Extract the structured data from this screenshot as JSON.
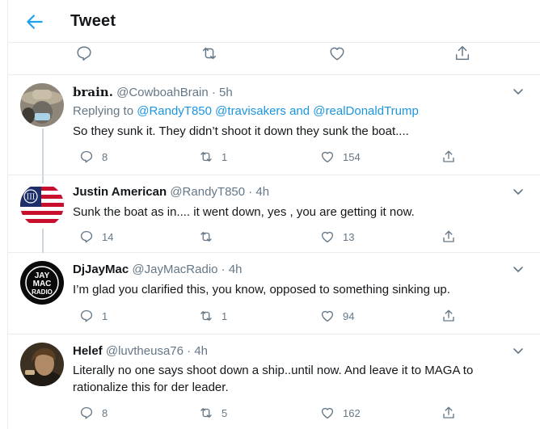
{
  "header": {
    "title": "Tweet"
  },
  "tweets": [
    {
      "name": "𝐛𝐫𝐚𝐢𝐧.",
      "handle": "@CowboahBrain · 5h",
      "replying_prefix": "Replying to",
      "replying_to_1": "@RandyT850",
      "replying_to_2": "@travisakers",
      "replying_and": "and",
      "replying_to_3": "@realDonaldTrump",
      "text": "So they sunk it. They didn’t shoot it down they sunk the boat....",
      "replies": "8",
      "retweets": "1",
      "likes": "154"
    },
    {
      "name": "Justin American",
      "handle": "@RandyT850 · 4h",
      "text": "Sunk the boat  as in.... it went down, yes , you are getting it now.",
      "replies": "14",
      "retweets": "",
      "likes": "13"
    },
    {
      "name": "DjJayMac",
      "handle": "@JayMacRadio · 4h",
      "text": "I’m glad you clarified this, you know, opposed to something sinking up.",
      "replies": "1",
      "retweets": "1",
      "likes": "94",
      "avatar_text": "JAY MAC RADIO"
    },
    {
      "name": "Helef",
      "handle": "@luvtheusa76 · 4h",
      "text": "Literally no one says shoot down a ship..until now. And leave it to MAGA to rationalize this for der leader.",
      "replies": "8",
      "retweets": "5",
      "likes": "162"
    }
  ],
  "colors": {
    "accent": "#1da1f2",
    "link": "#1b95e0",
    "muted": "#657786",
    "border": "#e6ecf0"
  },
  "icons": [
    "back-arrow-icon",
    "reply-icon",
    "retweet-icon",
    "like-icon",
    "share-icon",
    "caret-down-icon"
  ]
}
